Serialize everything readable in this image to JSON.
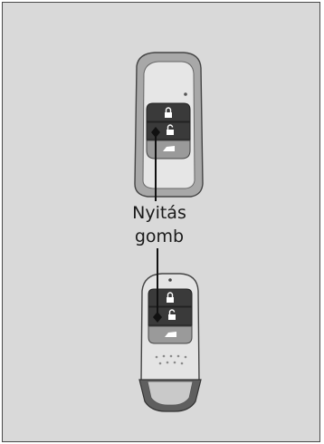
{
  "callout": {
    "line1": "Nyitás",
    "line2": "gomb"
  },
  "icons": [
    "lock-closed-icon",
    "lock-open-icon",
    "tailgate-icon"
  ],
  "colors": {
    "background": "#d9d9d9",
    "fob_shell": "#e6e6e6",
    "fob_frame": "#a9a9a9",
    "button_dark": "#3a3a3a",
    "button_light": "#9a9a9a",
    "outline": "#444444"
  }
}
